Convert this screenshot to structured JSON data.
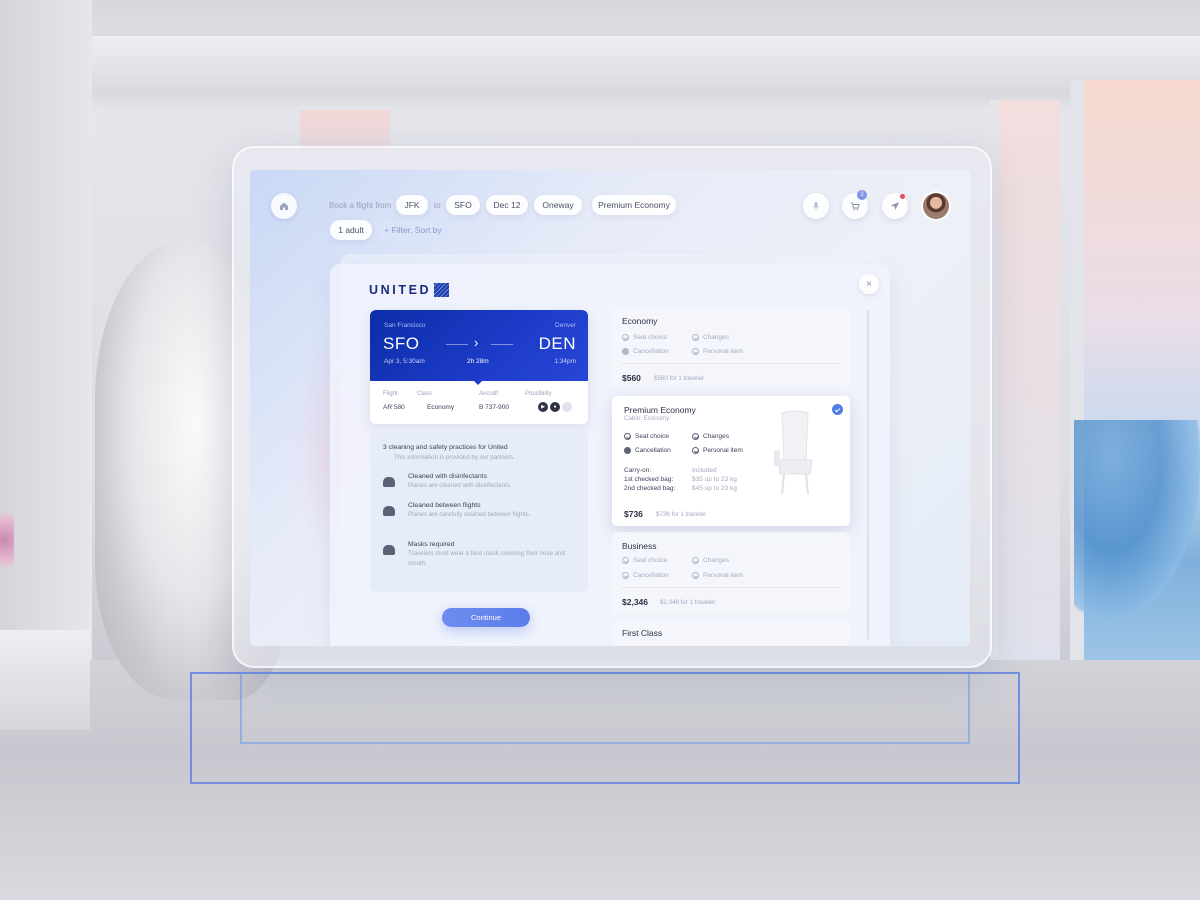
{
  "topbar": {
    "book_label": "Book a flight from",
    "from": "JFK",
    "to_label": "to",
    "to": "SFO",
    "date": "Dec 12",
    "trip_type": "Oneway",
    "cabin": "Premium Economy",
    "passengers": "1 adult",
    "filter_label": "+ Filter, Sort by",
    "cart_count": "2"
  },
  "modal": {
    "close_label": "×",
    "airline_logo": "UNITED",
    "ticket": {
      "origin_city": "San Francisco",
      "destination_city": "Denver",
      "origin_code": "SFO",
      "destination_code": "DEN",
      "departure": "Apr 3, 5:30am",
      "duration": "2h 28m",
      "arrival": "1:34pm",
      "arrow": "›",
      "labels": {
        "flight": "Flight",
        "class": "Class",
        "aircraft": "Aircraft",
        "possibility": "Possibility"
      },
      "flight": "AR 580",
      "class": "Economy",
      "aircraft": "B 737-900"
    },
    "safety": {
      "title": "3 cleaning and safety practices for United",
      "subtitle": "This information is provided by our partners.",
      "items": [
        {
          "title": "Cleaned with disinfectants",
          "desc": "Planes are cleaned with disinfectants."
        },
        {
          "title": "Cleaned between flights",
          "desc": "Planes are carefully cleaned between flights."
        },
        {
          "title": "Masks required",
          "desc": "Travelers must wear a face mask covering their nose and mouth."
        }
      ]
    },
    "continue_label": "Continue",
    "fares": [
      {
        "name": "Economy",
        "features": [
          "Seat choice",
          "Changes",
          "Cancellation",
          "Personal item"
        ],
        "price": "$560",
        "note": "$560 for 1 traveler"
      },
      {
        "name": "Premium Economy",
        "cabin": "Cabin: Economy",
        "features": [
          "Seat choice",
          "Changes",
          "Cancellation",
          "Personal item"
        ],
        "bags": [
          {
            "label": "Carry-on:",
            "value": "Included"
          },
          {
            "label": "1st checked bag:",
            "value": "$35 up to 23 kg"
          },
          {
            "label": "2nd checked bag:",
            "value": "$45 up to 23 kg"
          }
        ],
        "price": "$736",
        "note": "$736 for 1 traveler",
        "selected": true
      },
      {
        "name": "Business",
        "features": [
          "Seat choice",
          "Changes",
          "Cancellation",
          "Personal item"
        ],
        "price": "$2,346",
        "note": "$2,346 for 1 traveler"
      },
      {
        "name": "First Class"
      }
    ]
  },
  "colors": {
    "brand": "#1c3cc9",
    "accent": "#5b7de9",
    "badge": "#7f93e8",
    "alert": "#e84a5f"
  },
  "icons": [
    "home-icon",
    "mic-icon",
    "cart-icon",
    "send-icon",
    "close-icon",
    "arrow-right-icon",
    "check-icon",
    "dollar-icon"
  ]
}
